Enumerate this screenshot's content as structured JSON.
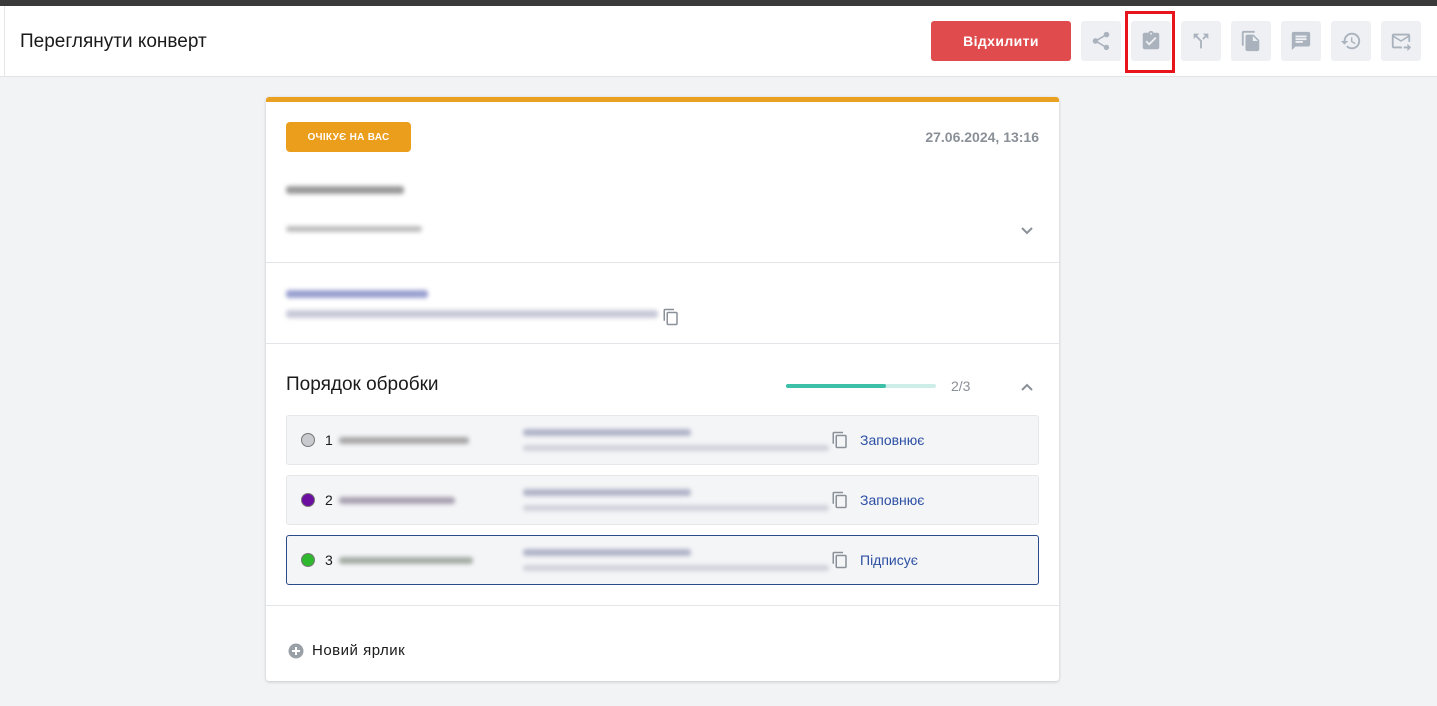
{
  "header": {
    "title": "Переглянути конверт",
    "reject_label": "Відхилити",
    "tools": [
      "share-icon",
      "clipboard-check-icon",
      "fork-icon",
      "copy-document-icon",
      "comment-icon",
      "history-icon",
      "forward-email-icon"
    ]
  },
  "envelope": {
    "status": "ОЧІКУЄ НА ВАС",
    "date": "27.06.2024, 13:16"
  },
  "workflow": {
    "title": "Порядок обробки",
    "progress_text": "2/3",
    "progress_fraction": 0.667,
    "steps": [
      {
        "number": "1",
        "role": "Заповнює",
        "dot_color": "#c8cacf"
      },
      {
        "number": "2",
        "role": "Заповнює",
        "dot_color": "#6a0fa0"
      },
      {
        "number": "3",
        "role": "Підписує",
        "dot_color": "#2eb82e"
      }
    ]
  },
  "labels": {
    "new_label": "Новий ярлик"
  },
  "colors": {
    "reject": "#e04b4d",
    "status_badge": "#eb9d1c",
    "card_accent": "#eaa121",
    "progress": "#3cc0a8",
    "role_link": "#2c4fa3",
    "highlight": "#e8141b"
  }
}
